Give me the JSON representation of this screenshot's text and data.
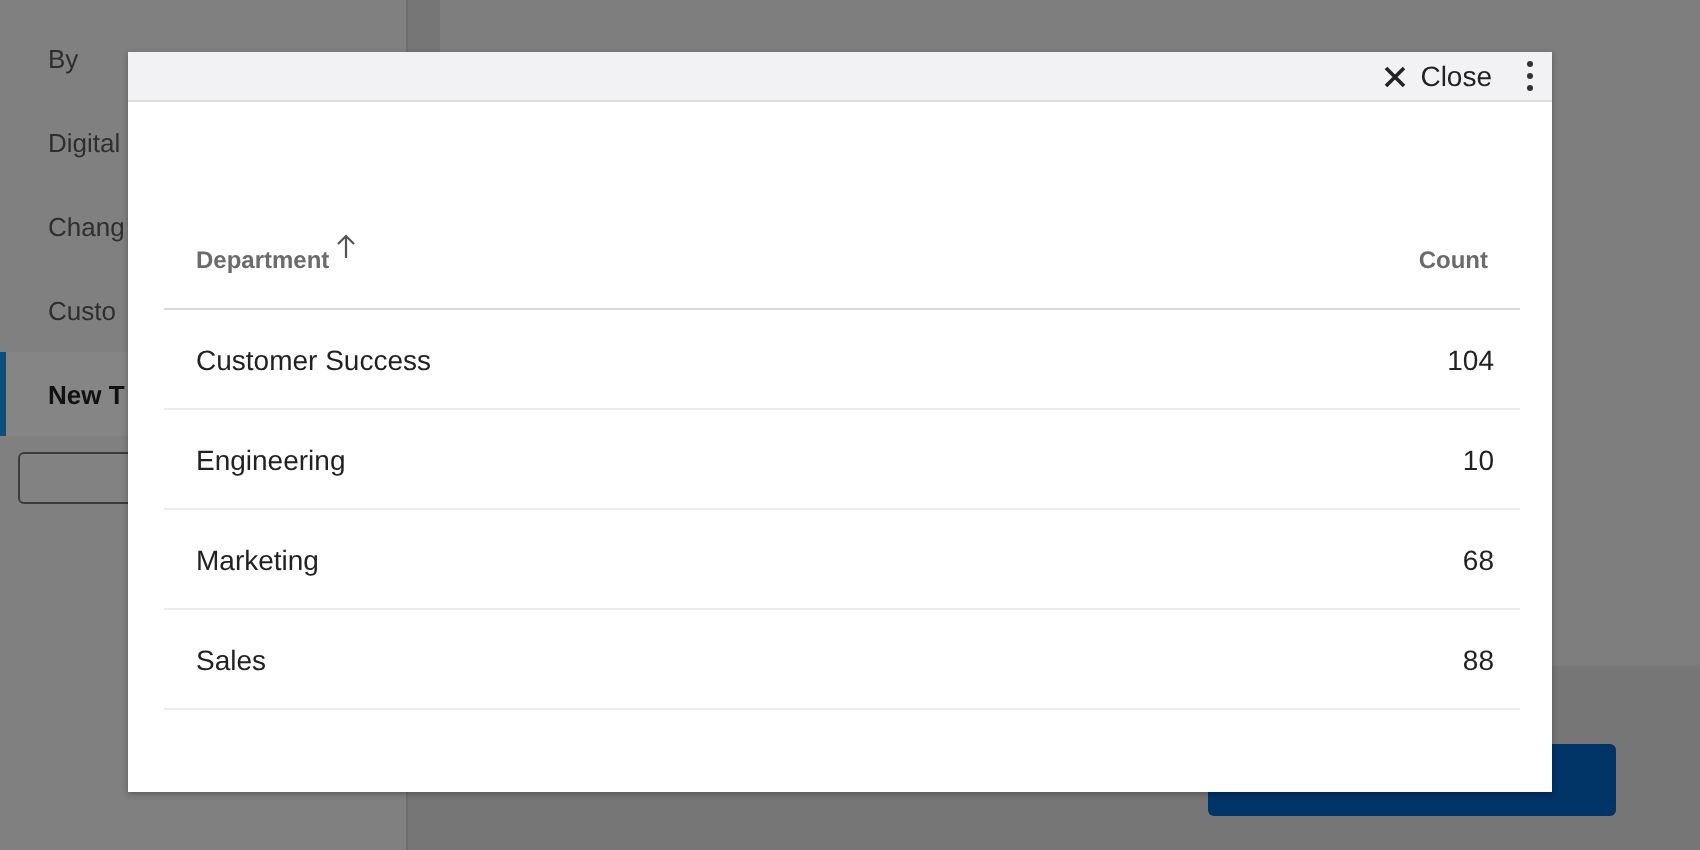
{
  "sidebar": {
    "items": [
      {
        "label": "By",
        "selected": false
      },
      {
        "label": "Digital",
        "selected": false
      },
      {
        "label": "Chang",
        "selected": false
      },
      {
        "label": "Custo",
        "selected": false
      },
      {
        "label": "New T",
        "selected": true
      }
    ]
  },
  "modal": {
    "close_label": "Close",
    "table": {
      "columns": [
        {
          "label": "Department",
          "sorted": true
        },
        {
          "label": "Count",
          "sorted": false
        }
      ],
      "rows": [
        [
          "Customer Success",
          "104"
        ],
        [
          "Engineering",
          "10"
        ],
        [
          "Marketing",
          "68"
        ],
        [
          "Sales",
          "88"
        ]
      ]
    }
  }
}
